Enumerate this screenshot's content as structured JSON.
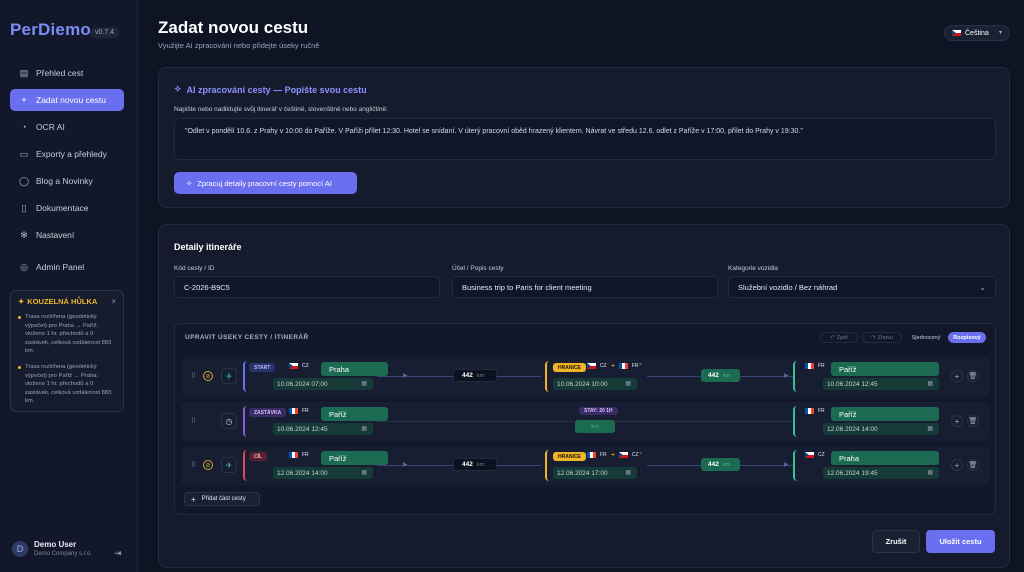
{
  "brand": {
    "name": "PerDiemo",
    "version": "v0.7.4"
  },
  "nav": [
    {
      "label": "Přehled cest",
      "icon": "calendar-icon"
    },
    {
      "label": "Zadat novou cestu",
      "icon": "plus-icon"
    },
    {
      "label": "OCR AI",
      "icon": "scan-icon"
    },
    {
      "label": "Exporty a přehledy",
      "icon": "document-icon"
    },
    {
      "label": "Blog a Novinky",
      "icon": "globe-icon"
    },
    {
      "label": "Dokumentace",
      "icon": "book-icon"
    },
    {
      "label": "Nastavení",
      "icon": "gear-icon"
    },
    {
      "label": "Admin Panel",
      "icon": "user-icon"
    }
  ],
  "magic": {
    "title": "KOUZELNÁ HŮLKA",
    "items": [
      "Trasa rozšířena (geodetický výpočet) pro Praha → Paříž: vloženo 1 hr. přechodů a 0 zastávek, celková vzdálenost 883 km.",
      "Trasa rozšířena (geodetický výpočet) pro Paříž → Praha: vloženo 1 hr. přechodů a 0 zastávek, celková vzdálenost 883 km."
    ]
  },
  "user": {
    "name": "Demo User",
    "company": "Demo Company s.r.o.",
    "initial": "D"
  },
  "header": {
    "title": "Zadat novou cestu",
    "subtitle": "Využijte AI zpracování nebo přidejte úseky ručně",
    "language": "Čeština"
  },
  "ai": {
    "title": "AI zpracování cesty — Popište svou cestu",
    "label": "Napište nebo nadiktujte svůj itinerář v češtině, slovenštině nebo angličtině:",
    "text": "\"Odlet v pondělí 10.6. z Prahy v 10:00 do Paříže. V Paříži přílet 12:30. Hotel se snídaní. V úterý pracovní oběd hrazený klientem. Návrat ve středu 12.6. odlet z Paříže v 17:00, přílet do Prahy v 19:30.\"",
    "button": "Zpracuj detaily pracovní cesty pomocí AI"
  },
  "details": {
    "title": "Detaily itineráře",
    "code_label": "Kód cesty / ID",
    "code_value": "C-2026-B9C5",
    "purpose_label": "Účel / Popis cesty",
    "purpose_value": "Business trip to Paris for client meeting",
    "vehicle_label": "Kategorie vozidla",
    "vehicle_value": "Služební vozidlo / Bez náhrad"
  },
  "segments": {
    "title": "UPRAVIT ÚSEKY CESTY / ITINERÁŘ",
    "controls": {
      "undo": "Zpět",
      "redo": "Znovu",
      "compact": "Sjednocený",
      "detailed": "Rozpisový"
    },
    "add": "Přidat část cesty",
    "km": "km",
    "rows": [
      {
        "tag": "START",
        "from_cc": "CZ",
        "from_city": "Praha",
        "from_dt": "10.06.2024 07:00",
        "dist1": "442",
        "border_tag": "HRANICE",
        "bc1": "CZ",
        "bc2": "FR",
        "border_dt": "10.06.2024 10:00",
        "dist2": "442",
        "to_cc": "FR",
        "to_city": "Paříž",
        "to_dt": "10.06.2024 12:45"
      },
      {
        "tag": "ZASTÁVKA",
        "from_cc": "FR",
        "from_city": "Paříž",
        "from_dt": "10.06.2024 12:45",
        "stay": "STAY: 20 1H",
        "stay_km": "km",
        "to_cc": "FR",
        "to_city": "Paříž",
        "to_dt": "12.06.2024 14:00"
      },
      {
        "tag": "CÍL",
        "from_cc": "FR",
        "from_city": "Paříž",
        "from_dt": "12.06.2024 14:00",
        "dist1": "442",
        "border_tag": "HRANICE",
        "bc1": "FR",
        "bc2": "CZ",
        "border_dt": "12.06.2024 17:00",
        "dist2": "442",
        "to_cc": "CZ",
        "to_city": "Praha",
        "to_dt": "12.06.2024 19:45"
      }
    ]
  },
  "actions": {
    "cancel": "Zrušit",
    "save": "Uložit cestu"
  }
}
